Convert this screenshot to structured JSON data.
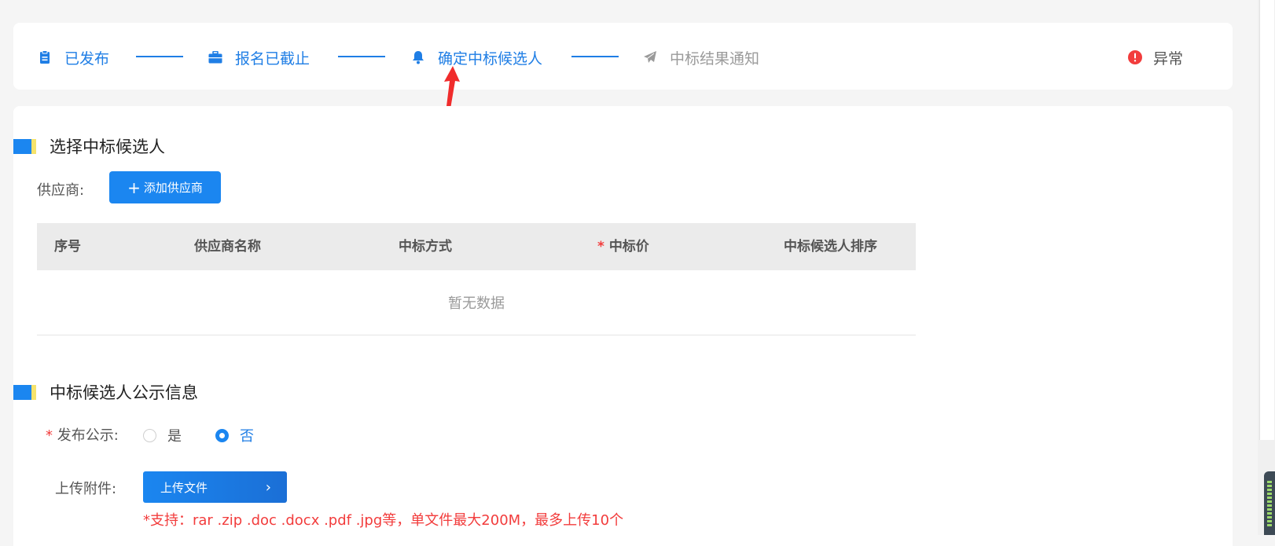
{
  "steps": [
    {
      "label": "已发布",
      "state": "active",
      "icon": "clipboard-icon"
    },
    {
      "label": "报名已截止",
      "state": "active",
      "icon": "briefcase-icon"
    },
    {
      "label": "确定中标候选人",
      "state": "active",
      "icon": "bell-icon"
    },
    {
      "label": "中标结果通知",
      "state": "inactive",
      "icon": "paper-plane-icon"
    }
  ],
  "exception": {
    "label": "异常",
    "icon": "alert-circle-icon",
    "color": "#f23c3c"
  },
  "section1": {
    "title": "选择中标候选人",
    "supplier_label": "供应商:",
    "add_button": "添加供应商",
    "add_icon": "plus-icon",
    "table": {
      "columns": [
        "序号",
        "供应商名称",
        "中标方式",
        "中标价",
        "中标候选人排序"
      ],
      "required_marker": "*",
      "empty_text": "暂无数据"
    }
  },
  "section2": {
    "title": "中标候选人公示信息",
    "publish_label": "发布公示:",
    "required_marker": "*",
    "options": [
      {
        "label": "是",
        "checked": false
      },
      {
        "label": "否",
        "checked": true
      }
    ],
    "upload_label": "上传附件:",
    "upload_button": "上传文件",
    "upload_hint": "*支持：rar .zip .doc .docx .pdf .jpg等，单文件最大200M，最多上传10个"
  },
  "colors": {
    "primary": "#1b86f0",
    "accent": "#f6e36c",
    "danger": "#f23c3c",
    "annotation_arrow": "#f02c2c"
  }
}
